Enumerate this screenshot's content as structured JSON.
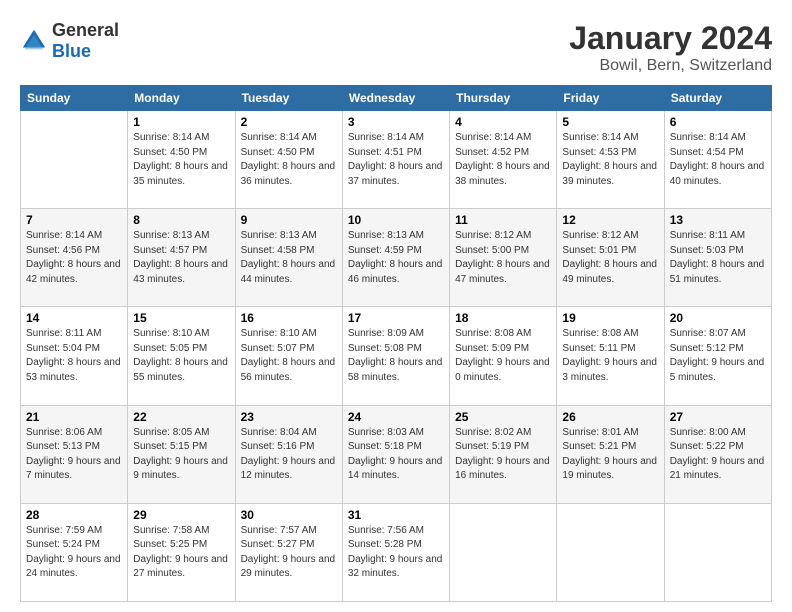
{
  "header": {
    "logo": {
      "general": "General",
      "blue": "Blue"
    },
    "title": "January 2024",
    "location": "Bowil, Bern, Switzerland"
  },
  "days_of_week": [
    "Sunday",
    "Monday",
    "Tuesday",
    "Wednesday",
    "Thursday",
    "Friday",
    "Saturday"
  ],
  "weeks": [
    [
      {
        "day": "",
        "sunrise": "",
        "sunset": "",
        "daylight": ""
      },
      {
        "day": "1",
        "sunrise": "Sunrise: 8:14 AM",
        "sunset": "Sunset: 4:50 PM",
        "daylight": "Daylight: 8 hours and 35 minutes."
      },
      {
        "day": "2",
        "sunrise": "Sunrise: 8:14 AM",
        "sunset": "Sunset: 4:50 PM",
        "daylight": "Daylight: 8 hours and 36 minutes."
      },
      {
        "day": "3",
        "sunrise": "Sunrise: 8:14 AM",
        "sunset": "Sunset: 4:51 PM",
        "daylight": "Daylight: 8 hours and 37 minutes."
      },
      {
        "day": "4",
        "sunrise": "Sunrise: 8:14 AM",
        "sunset": "Sunset: 4:52 PM",
        "daylight": "Daylight: 8 hours and 38 minutes."
      },
      {
        "day": "5",
        "sunrise": "Sunrise: 8:14 AM",
        "sunset": "Sunset: 4:53 PM",
        "daylight": "Daylight: 8 hours and 39 minutes."
      },
      {
        "day": "6",
        "sunrise": "Sunrise: 8:14 AM",
        "sunset": "Sunset: 4:54 PM",
        "daylight": "Daylight: 8 hours and 40 minutes."
      }
    ],
    [
      {
        "day": "7",
        "sunrise": "Sunrise: 8:14 AM",
        "sunset": "Sunset: 4:56 PM",
        "daylight": "Daylight: 8 hours and 42 minutes."
      },
      {
        "day": "8",
        "sunrise": "Sunrise: 8:13 AM",
        "sunset": "Sunset: 4:57 PM",
        "daylight": "Daylight: 8 hours and 43 minutes."
      },
      {
        "day": "9",
        "sunrise": "Sunrise: 8:13 AM",
        "sunset": "Sunset: 4:58 PM",
        "daylight": "Daylight: 8 hours and 44 minutes."
      },
      {
        "day": "10",
        "sunrise": "Sunrise: 8:13 AM",
        "sunset": "Sunset: 4:59 PM",
        "daylight": "Daylight: 8 hours and 46 minutes."
      },
      {
        "day": "11",
        "sunrise": "Sunrise: 8:12 AM",
        "sunset": "Sunset: 5:00 PM",
        "daylight": "Daylight: 8 hours and 47 minutes."
      },
      {
        "day": "12",
        "sunrise": "Sunrise: 8:12 AM",
        "sunset": "Sunset: 5:01 PM",
        "daylight": "Daylight: 8 hours and 49 minutes."
      },
      {
        "day": "13",
        "sunrise": "Sunrise: 8:11 AM",
        "sunset": "Sunset: 5:03 PM",
        "daylight": "Daylight: 8 hours and 51 minutes."
      }
    ],
    [
      {
        "day": "14",
        "sunrise": "Sunrise: 8:11 AM",
        "sunset": "Sunset: 5:04 PM",
        "daylight": "Daylight: 8 hours and 53 minutes."
      },
      {
        "day": "15",
        "sunrise": "Sunrise: 8:10 AM",
        "sunset": "Sunset: 5:05 PM",
        "daylight": "Daylight: 8 hours and 55 minutes."
      },
      {
        "day": "16",
        "sunrise": "Sunrise: 8:10 AM",
        "sunset": "Sunset: 5:07 PM",
        "daylight": "Daylight: 8 hours and 56 minutes."
      },
      {
        "day": "17",
        "sunrise": "Sunrise: 8:09 AM",
        "sunset": "Sunset: 5:08 PM",
        "daylight": "Daylight: 8 hours and 58 minutes."
      },
      {
        "day": "18",
        "sunrise": "Sunrise: 8:08 AM",
        "sunset": "Sunset: 5:09 PM",
        "daylight": "Daylight: 9 hours and 0 minutes."
      },
      {
        "day": "19",
        "sunrise": "Sunrise: 8:08 AM",
        "sunset": "Sunset: 5:11 PM",
        "daylight": "Daylight: 9 hours and 3 minutes."
      },
      {
        "day": "20",
        "sunrise": "Sunrise: 8:07 AM",
        "sunset": "Sunset: 5:12 PM",
        "daylight": "Daylight: 9 hours and 5 minutes."
      }
    ],
    [
      {
        "day": "21",
        "sunrise": "Sunrise: 8:06 AM",
        "sunset": "Sunset: 5:13 PM",
        "daylight": "Daylight: 9 hours and 7 minutes."
      },
      {
        "day": "22",
        "sunrise": "Sunrise: 8:05 AM",
        "sunset": "Sunset: 5:15 PM",
        "daylight": "Daylight: 9 hours and 9 minutes."
      },
      {
        "day": "23",
        "sunrise": "Sunrise: 8:04 AM",
        "sunset": "Sunset: 5:16 PM",
        "daylight": "Daylight: 9 hours and 12 minutes."
      },
      {
        "day": "24",
        "sunrise": "Sunrise: 8:03 AM",
        "sunset": "Sunset: 5:18 PM",
        "daylight": "Daylight: 9 hours and 14 minutes."
      },
      {
        "day": "25",
        "sunrise": "Sunrise: 8:02 AM",
        "sunset": "Sunset: 5:19 PM",
        "daylight": "Daylight: 9 hours and 16 minutes."
      },
      {
        "day": "26",
        "sunrise": "Sunrise: 8:01 AM",
        "sunset": "Sunset: 5:21 PM",
        "daylight": "Daylight: 9 hours and 19 minutes."
      },
      {
        "day": "27",
        "sunrise": "Sunrise: 8:00 AM",
        "sunset": "Sunset: 5:22 PM",
        "daylight": "Daylight: 9 hours and 21 minutes."
      }
    ],
    [
      {
        "day": "28",
        "sunrise": "Sunrise: 7:59 AM",
        "sunset": "Sunset: 5:24 PM",
        "daylight": "Daylight: 9 hours and 24 minutes."
      },
      {
        "day": "29",
        "sunrise": "Sunrise: 7:58 AM",
        "sunset": "Sunset: 5:25 PM",
        "daylight": "Daylight: 9 hours and 27 minutes."
      },
      {
        "day": "30",
        "sunrise": "Sunrise: 7:57 AM",
        "sunset": "Sunset: 5:27 PM",
        "daylight": "Daylight: 9 hours and 29 minutes."
      },
      {
        "day": "31",
        "sunrise": "Sunrise: 7:56 AM",
        "sunset": "Sunset: 5:28 PM",
        "daylight": "Daylight: 9 hours and 32 minutes."
      },
      {
        "day": "",
        "sunrise": "",
        "sunset": "",
        "daylight": ""
      },
      {
        "day": "",
        "sunrise": "",
        "sunset": "",
        "daylight": ""
      },
      {
        "day": "",
        "sunrise": "",
        "sunset": "",
        "daylight": ""
      }
    ]
  ]
}
